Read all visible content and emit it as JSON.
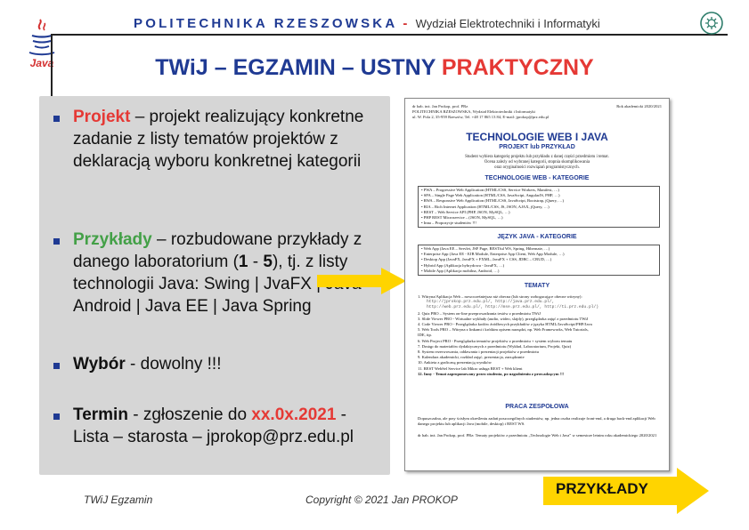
{
  "header": {
    "university": "POLITECHNIKA RZESZOWSKA",
    "separator": "-",
    "faculty": "Wydział Elektrotechniki i Informatyki",
    "java_logo_text": "Java"
  },
  "title": {
    "main": "TWiJ – EGZAMIN – USTNY",
    "highlight": "PRAKTYCZNY"
  },
  "bullets": [
    {
      "keyword": "Projekt",
      "text": " – projekt realizujący konkretne zadanie z listy tematów projektów z deklaracją wyboru konkretnej kategorii"
    },
    {
      "keyword": "Przykłady",
      "text_a": " – rozbudowane przykłady z danego laboratorium (",
      "n1": "1",
      "dash": " - ",
      "n2": "5",
      "text_b": "), tj. z listy technologii Java: Swing | JvaFX | Java Android | Java EE | Java Spring"
    },
    {
      "keyword": "Wybór",
      "text": " - dowolny !!!"
    },
    {
      "keyword": "Termin",
      "text_a": " - zgłoszenie do ",
      "date": "xx.0x.2021",
      "text_b": " - Lista – starosta – jprokop@prz.edu.pl"
    }
  ],
  "document": {
    "author_left": "dr hab. inż. Jan Prokop, prof. PRz",
    "inst_line": "POLITECHNIKA RZESZOWSKA, Wydział Elektrotechniki i Informatyki",
    "addr_line": "ul. W. Pola 2, 35-959 Rzeszów, Tel. +48 17 865 13 84, E-mail: jprokop@prz.edu.pl",
    "year": "Rok akademicki 2020/2021",
    "title": "TECHNOLOGIE WEB I JAVA",
    "subtitle": "PROJEKT lub PRZYKŁAD",
    "intro1": "Student wybiera kategorię projektu lub przykładu z danej części przedmiotu i temat.",
    "intro2": "Ocena zależy od wybranej kategorii, stopnia skomplikowania",
    "intro3": "oraz oryginalności rozwiązań programistycznych.",
    "web_header": "TECHNOLOGIE WEB - KATEGORIE",
    "web_items": [
      "• PWA – Progressive Web Application (HTML/CSS, Service Workers, Manifest, …)",
      "• SPA – Single Page Web Application (HTML/CSS, JavaScript, AngularJS, PHP, …)",
      "• RWA – Responsive Web Application (HTML/CSS, JavaScript, Bootstrap, jQuery, …)",
      "• RIA – Rich Internet Application (HTML/CSS, JS, JSON, AJAX, jQuery, …)",
      "• REST – Web Service API (PHP, JSON, MySQL, …)",
      "• PHP REST Microservice – (JSON, MySQL, …)",
      "• Inna – Propozycje studentów !!!"
    ],
    "java_header": "JĘZYK JAVA - KATEGORIE",
    "java_items": [
      "• Web App (Java EE – Servlet, JSF Page, RESTful WS, Spring, Hibernate, …)",
      "• Enterprise App (Java EE - EJB Module, Enterprise App Client, Web App Module, …)",
      "• Desktop App (JavaFX, JavaFX + FXML, JavaFX + CSS, JDBC – CRUD, …)",
      "• Hybrid App (Aplikacja hybrydowa - JavaFX, …)",
      "• Mobile App (Aplikacja mobilna, Android, …)"
    ],
    "topics_header": "TEMATY",
    "topics": [
      {
        "t": "1. Witryna/Aplikacja Web – nowocześniejsza niż obecna (lub strony wzbogacające obecne witryny):",
        "mono": false
      },
      {
        "t": "http://jprokop.prz.edu.pl/, http://java.prz.edu.pl/,",
        "mono": true
      },
      {
        "t": "http://web.prz.edu.pl/, http://mse.prz.edu.pl/, http://ti.prz.edu.pl/)",
        "mono": true
      },
      {
        "t": "2. Quiz PRO – System on-line przeprowadzania testów z przedmiotu TWiJ",
        "mono": false
      },
      {
        "t": "3. Slide Viewer PRO - Wirtualne wykłady (audio, wideo, slajdy), przeglądarka zajęć z przedmiotu TWiJ",
        "mono": false
      },
      {
        "t": "4. Code Viewer PRO - Przeglądarka kodów źródłowych przykładów z języka HTML/JavaScript/PHP/Java",
        "mono": false
      },
      {
        "t": "5. Web Tools PRO – Witryna z linkami i krótkim opisem narzędzi, np. Web Frameworks, Web Tutorials,",
        "mono": false
      },
      {
        "t": "   IDE, itp.",
        "mono": false
      },
      {
        "t": "6. Web Project PRO - Przeglądarka tematów projektów z przedmiotu + system wyboru tematu",
        "mono": false
      },
      {
        "t": "7. Dostęp do materiałów dydaktycznych z przedmiotu (Wykład, Laboratorium, Projekt, Quiz)",
        "mono": false
      },
      {
        "t": "8. System rezerwowania, oddawania i prezentacji projektów z przedmiotu",
        "mono": false
      },
      {
        "t": "9. Kalendarz akademicki, rozkład zajęć, prezentacja, zarządzanie",
        "mono": false
      },
      {
        "t": "10. Ankieta z graficzną prezentacją wyników",
        "mono": false
      },
      {
        "t": "11. REST WebSel Service lab Mikro usługa REST + Web klient",
        "mono": false
      },
      {
        "t": "12. Inny - Temat zaproponowany przez studenta, po uzgodnieniu z prowadzącym !!!",
        "mono": false
      }
    ],
    "team_header": "PRACA ZESPOŁOWA",
    "team_text": "Dopuszczalna, ale przy ścisłym określeniu zadań poszczególnych studentów, np. jedna osoba realizuje front-end, a druga back-end aplikacji Web danego projektu lub aplikacji Java (mobile, desktop) i REST WS.",
    "footer_note": "dr hab. inż. Jan Prokop, prof. PRz: Tematy projektów z przedmiotu „Technologie Web i Java” w semestrze letnim roku akademickiego 2020/2021"
  },
  "footer": {
    "left": "TWiJ Egzamin",
    "center": "Copyright © 2021 Jan PROKOP",
    "button": "PRZYKŁADY"
  },
  "colors": {
    "navy": "#1f3a93",
    "red": "#e53935",
    "green": "#43a047",
    "arrow": "#ffd400",
    "panel": "#d6d6d6"
  }
}
